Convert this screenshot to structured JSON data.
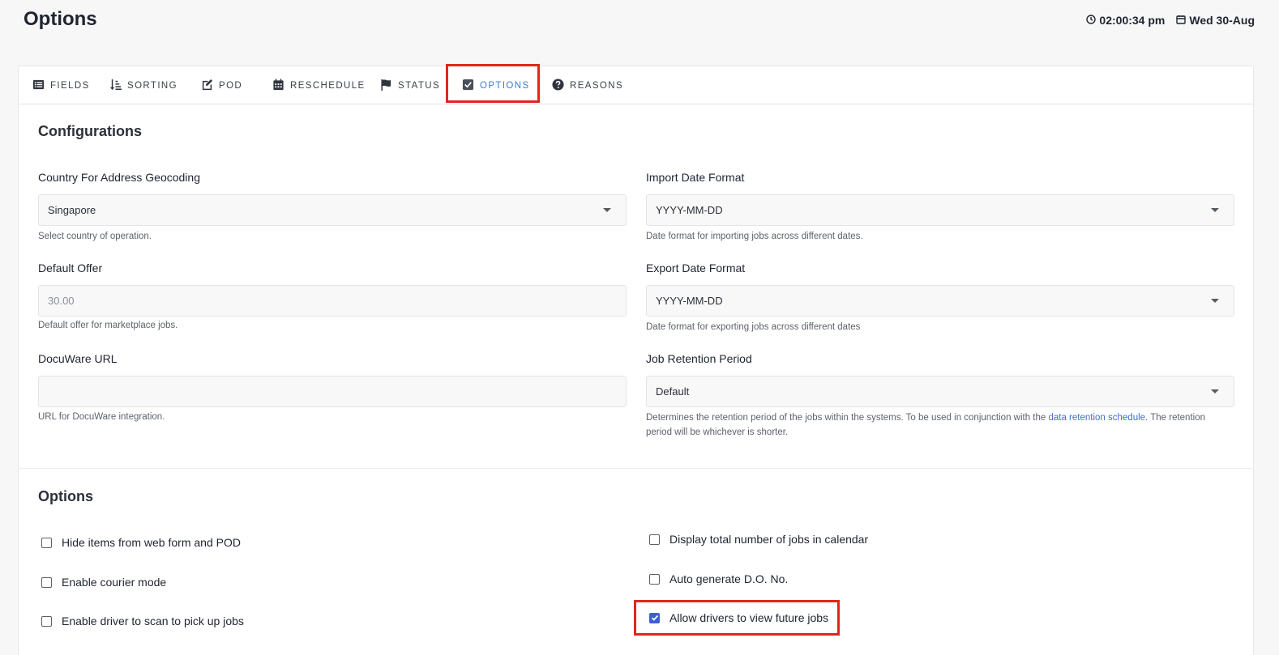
{
  "header": {
    "title": "Options",
    "time": "02:00:34 pm",
    "date": "Wed 30-Aug"
  },
  "tabs": [
    {
      "label": "FIELDS",
      "icon": "list-icon"
    },
    {
      "label": "SORTING",
      "icon": "sort-icon"
    },
    {
      "label": "POD",
      "icon": "edit-icon"
    },
    {
      "label": "RESCHEDULE",
      "icon": "calendar-icon"
    },
    {
      "label": "STATUS",
      "icon": "flag-icon"
    },
    {
      "label": "OPTIONS",
      "icon": "check-square-icon",
      "active": true
    },
    {
      "label": "REASONS",
      "icon": "question-circle-icon"
    }
  ],
  "configurations": {
    "title": "Configurations",
    "country": {
      "label": "Country For Address Geocoding",
      "value": "Singapore",
      "help": "Select country of operation."
    },
    "default_offer": {
      "label": "Default Offer",
      "placeholder": "30.00",
      "help": "Default offer for marketplace jobs."
    },
    "docuware": {
      "label": "DocuWare URL",
      "value": "",
      "help": "URL for DocuWare integration."
    },
    "import_date": {
      "label": "Import Date Format",
      "value": "YYYY-MM-DD",
      "help": "Date format for importing jobs across different dates."
    },
    "export_date": {
      "label": "Export Date Format",
      "value": "YYYY-MM-DD",
      "help": "Date format for exporting jobs across different dates"
    },
    "retention": {
      "label": "Job Retention Period",
      "value": "Default",
      "help_pre": "Determines the retention period of the jobs within the systems. To be used in conjunction with the ",
      "help_link": "data retention schedule",
      "help_post": ". The retention period will be whichever is shorter."
    }
  },
  "options": {
    "title": "Options",
    "left": [
      {
        "label": "Hide items from web form and POD",
        "checked": false
      },
      {
        "label": "Enable courier mode",
        "checked": false
      },
      {
        "label": "Enable driver to scan to pick up jobs",
        "checked": false
      }
    ],
    "right": [
      {
        "label": "Display total number of jobs in calendar",
        "checked": false
      },
      {
        "label": "Auto generate D.O. No.",
        "checked": false
      },
      {
        "label": "Allow drivers to view future jobs",
        "checked": true
      }
    ]
  },
  "colors": {
    "accent": "#3a7bd5",
    "highlight": "#e0261c",
    "checkbox": "#3d5fd6"
  }
}
